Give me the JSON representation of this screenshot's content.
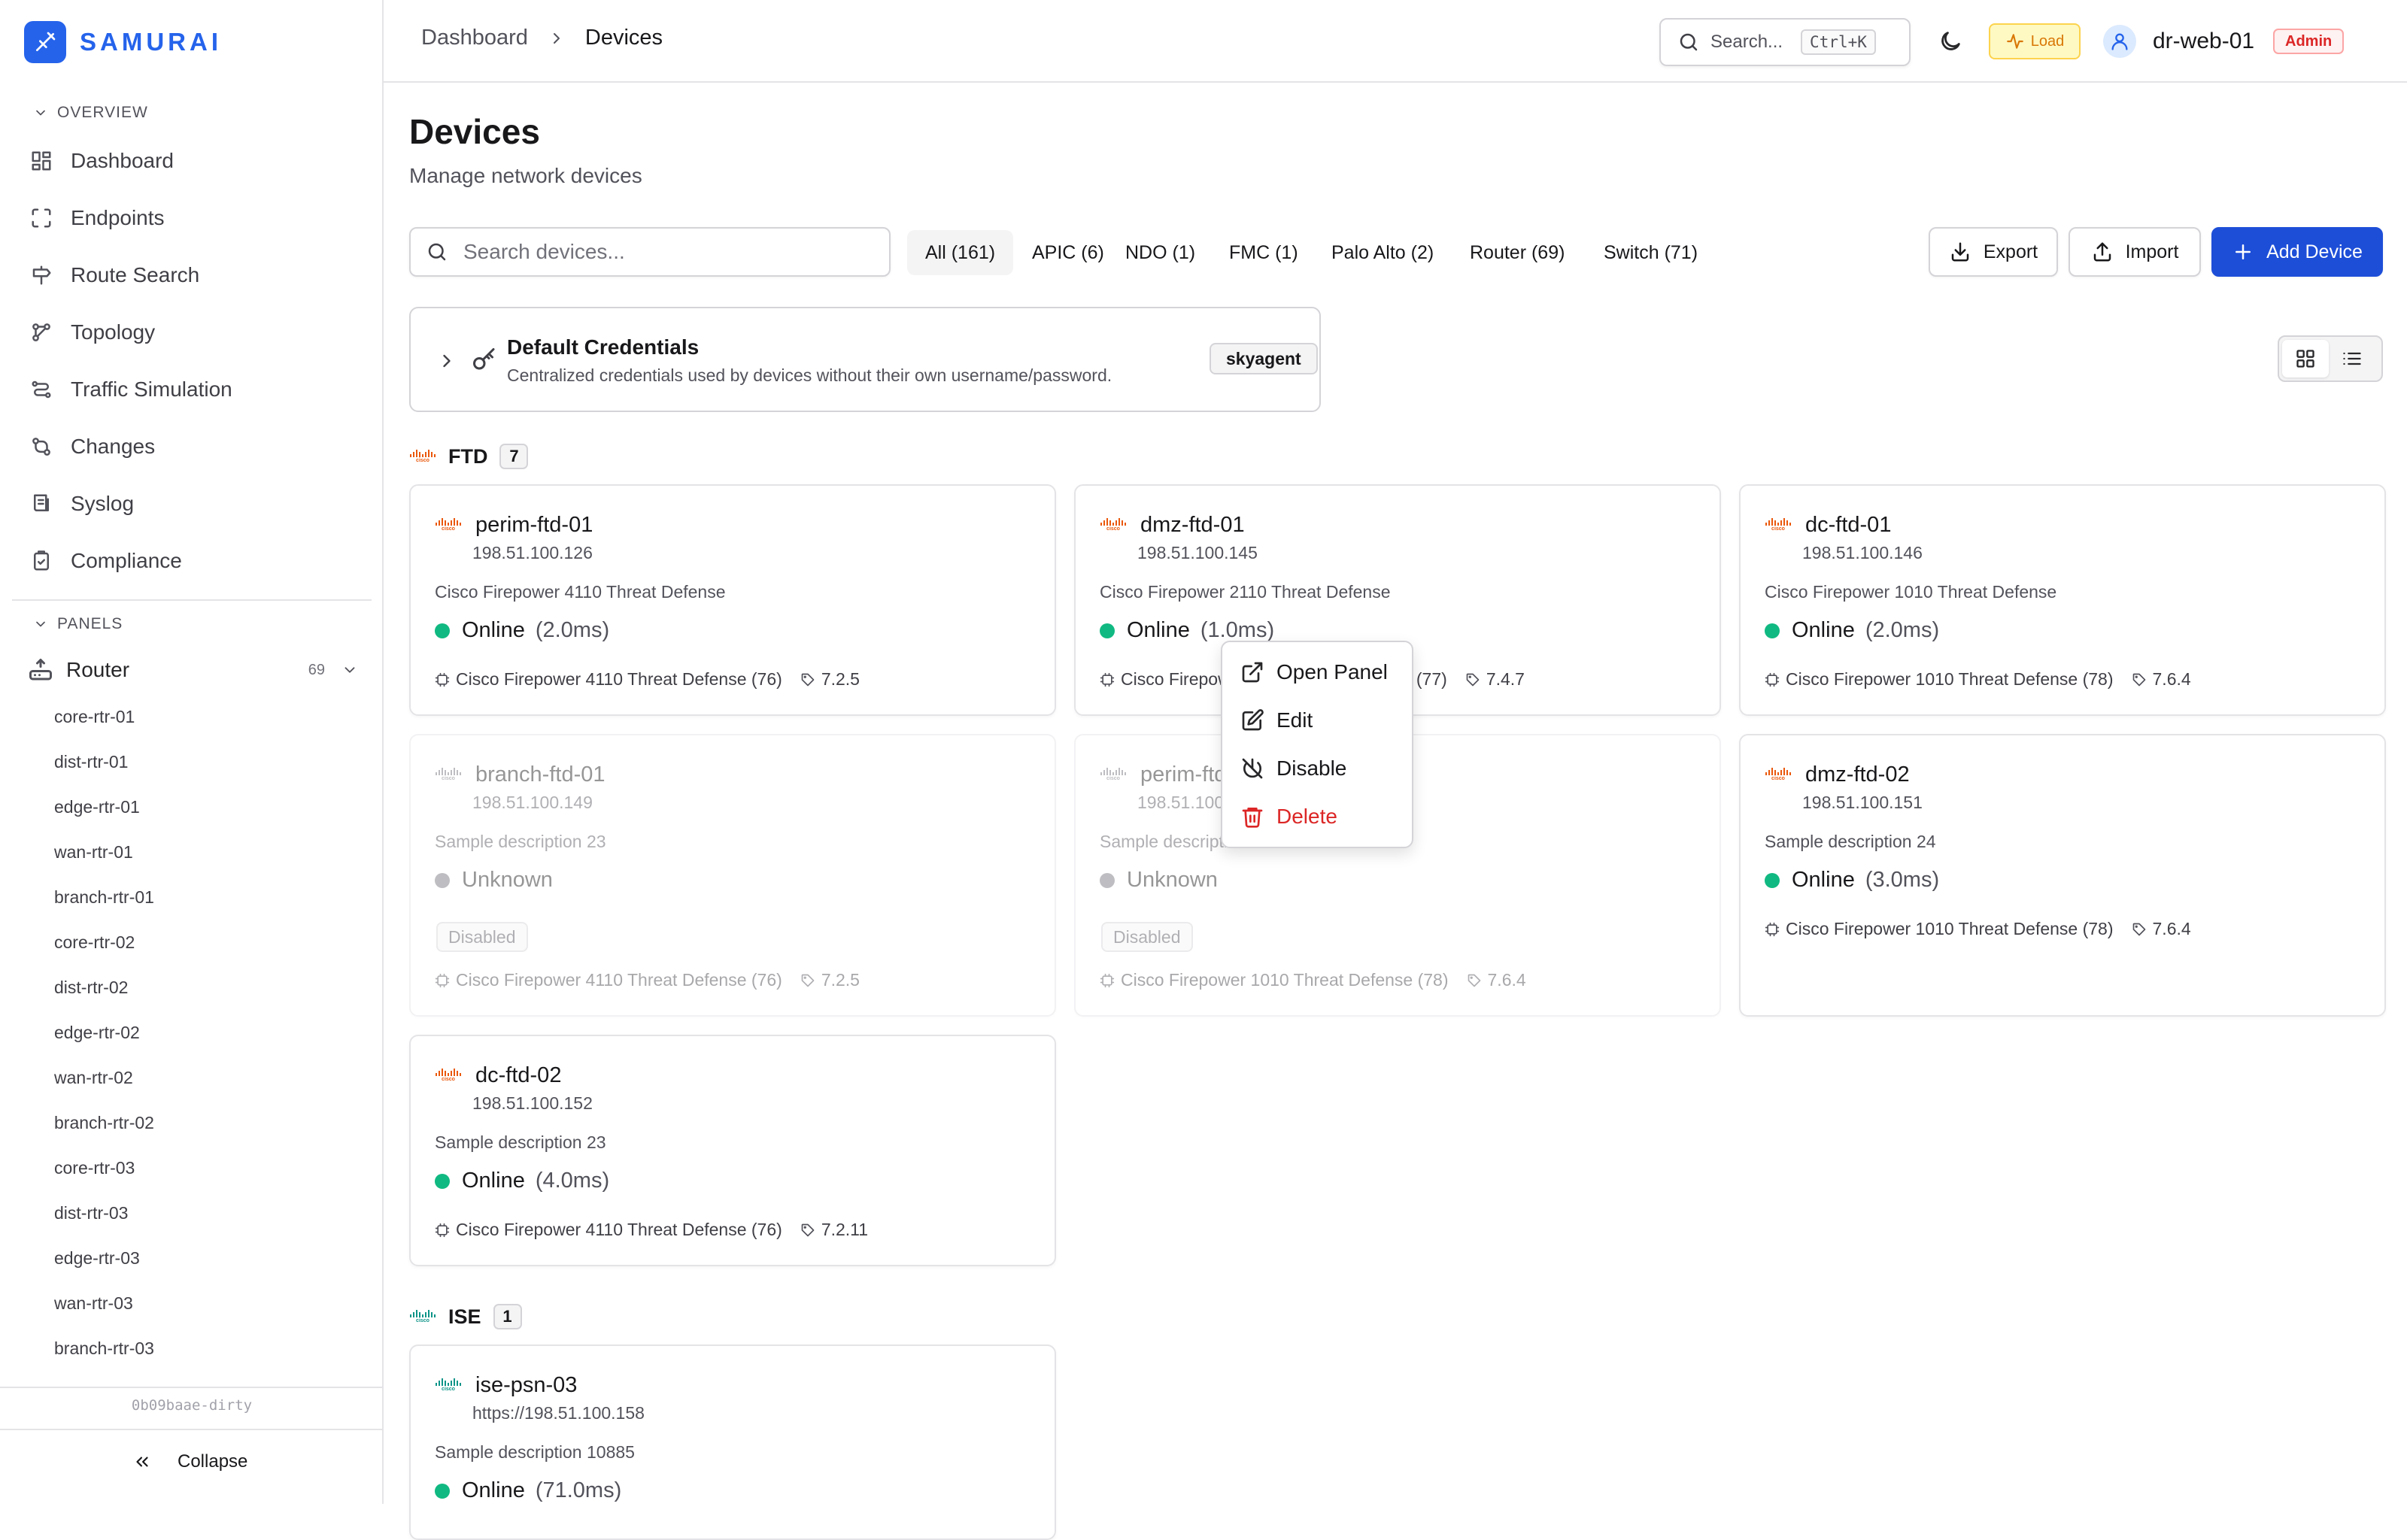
{
  "app": {
    "name": "SAMURAI",
    "version": "0b09baae-dirty",
    "collapse_label": "Collapse"
  },
  "sidebar": {
    "overview_label": "OVERVIEW",
    "items": [
      {
        "label": "Dashboard",
        "icon": "dashboard-icon"
      },
      {
        "label": "Endpoints",
        "icon": "endpoints-icon"
      },
      {
        "label": "Route Search",
        "icon": "route-search-icon"
      },
      {
        "label": "Topology",
        "icon": "topology-icon"
      },
      {
        "label": "Traffic Simulation",
        "icon": "traffic-simulation-icon"
      },
      {
        "label": "Changes",
        "icon": "changes-icon"
      },
      {
        "label": "Syslog",
        "icon": "syslog-icon"
      },
      {
        "label": "Compliance",
        "icon": "compliance-icon"
      }
    ],
    "panels_label": "PANELS",
    "router_panel": {
      "label": "Router",
      "count": "69"
    },
    "routers": [
      "core-rtr-01",
      "dist-rtr-01",
      "edge-rtr-01",
      "wan-rtr-01",
      "branch-rtr-01",
      "core-rtr-02",
      "dist-rtr-02",
      "edge-rtr-02",
      "wan-rtr-02",
      "branch-rtr-02",
      "core-rtr-03",
      "dist-rtr-03",
      "edge-rtr-03",
      "wan-rtr-03",
      "branch-rtr-03"
    ]
  },
  "topbar": {
    "breadcrumb": [
      "Dashboard",
      "Devices"
    ],
    "search_placeholder": "Search...",
    "search_shortcut": "Ctrl+K",
    "load_label": "Load",
    "username": "dr-web-01",
    "role": "Admin"
  },
  "page": {
    "title": "Devices",
    "subtitle": "Manage network devices",
    "search_placeholder": "Search devices...",
    "filters": [
      "All (161)",
      "APIC (6)",
      "NDO (1)",
      "FMC (1)",
      "Palo Alto (2)",
      "Router (69)",
      "Switch (71)"
    ],
    "active_filter": "All (161)",
    "export_label": "Export",
    "import_label": "Import",
    "add_label": "Add Device"
  },
  "credentials": {
    "title": "Default Credentials",
    "description": "Centralized credentials used by devices without their own username/password.",
    "username": "skyagent"
  },
  "colors": {
    "accent": "#1d4ed8",
    "online": "#10b981",
    "unknown": "#71717a",
    "cisco_ftd": "#ea580c",
    "cisco_ise": "#0d9488",
    "danger": "#dc2626"
  },
  "groups": [
    {
      "name": "FTD",
      "count": "7",
      "devices": [
        {
          "name": "perim-ftd-01",
          "ip": "198.51.100.126",
          "desc": "Cisco Firepower 4110 Threat Defense",
          "status": "Online",
          "latency": "(2.0ms)",
          "model": "Cisco Firepower 4110 Threat Defense (76)",
          "version": "7.2.5"
        },
        {
          "name": "dmz-ftd-01",
          "ip": "198.51.100.145",
          "desc": "Cisco Firepower 2110 Threat Defense",
          "status": "Online",
          "latency": "(1.0ms)",
          "model": "Cisco Firepower 2110 Threat Defense (77)",
          "version": "7.4.7"
        },
        {
          "name": "dc-ftd-01",
          "ip": "198.51.100.146",
          "desc": "Cisco Firepower 1010 Threat Defense",
          "status": "Online",
          "latency": "(2.0ms)",
          "model": "Cisco Firepower 1010 Threat Defense (78)",
          "version": "7.6.4"
        },
        {
          "name": "branch-ftd-01",
          "ip": "198.51.100.149",
          "desc": "Sample description 23",
          "status": "Unknown",
          "latency": "",
          "disabled": "Disabled",
          "model": "Cisco Firepower 4110 Threat Defense (76)",
          "version": "7.2.5"
        },
        {
          "name": "perim-ftd-02",
          "ip": "198.51.100.150",
          "desc": "Sample description 24",
          "status": "Unknown",
          "latency": "",
          "disabled": "Disabled",
          "model": "Cisco Firepower 1010 Threat Defense (78)",
          "version": "7.6.4"
        },
        {
          "name": "dmz-ftd-02",
          "ip": "198.51.100.151",
          "desc": "Sample description 24",
          "status": "Online",
          "latency": "(3.0ms)",
          "model": "Cisco Firepower 1010 Threat Defense (78)",
          "version": "7.6.4"
        },
        {
          "name": "dc-ftd-02",
          "ip": "198.51.100.152",
          "desc": "Sample description 23",
          "status": "Online",
          "latency": "(4.0ms)",
          "model": "Cisco Firepower 4110 Threat Defense (76)",
          "version": "7.2.11"
        }
      ]
    },
    {
      "name": "ISE",
      "count": "1",
      "devices": [
        {
          "name": "ise-psn-03",
          "ip": "https://198.51.100.158",
          "desc": "Sample description 10885",
          "status": "Online",
          "latency": "(71.0ms)"
        }
      ]
    }
  ],
  "context_menu": {
    "items": [
      "Open Panel",
      "Edit",
      "Disable",
      "Delete"
    ]
  },
  "cisco_word": "cisco"
}
